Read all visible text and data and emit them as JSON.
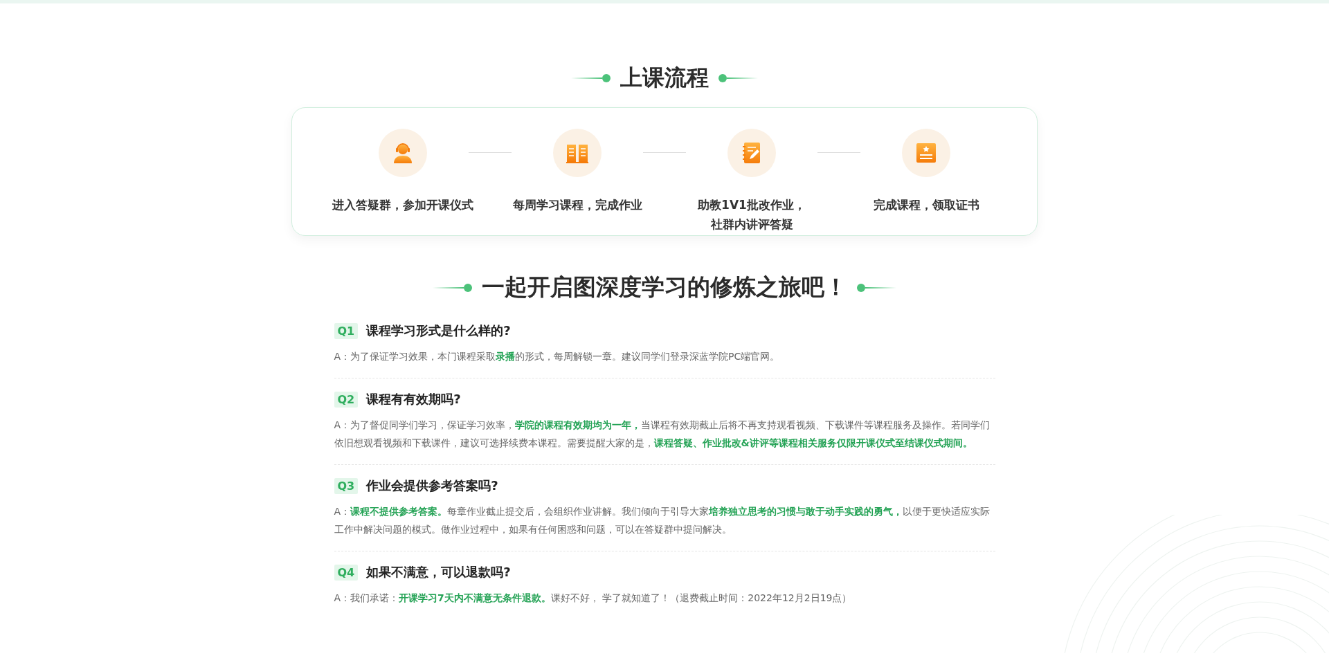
{
  "process": {
    "title": "上课流程",
    "steps": [
      {
        "kind": "headset",
        "lines": [
          "进入答疑群，参加开课仪式"
        ]
      },
      {
        "kind": "book",
        "lines": [
          "每周学习课程，完成作业"
        ]
      },
      {
        "kind": "notebook",
        "lines": [
          "助教1V1批改作业，",
          "社群内讲评答疑"
        ]
      },
      {
        "kind": "certificate",
        "lines": [
          "完成课程，领取证书"
        ]
      }
    ]
  },
  "faq": {
    "title": "一起开启图深度学习的修炼之旅吧！",
    "items": [
      {
        "tag": "Q1",
        "question": "课程学习形式是什么样的?",
        "answer": "A：为了保证学习效果，本门课程采取**录播**的形式，每周解锁一章。建议同学们登录深蓝学院PC端官网。"
      },
      {
        "tag": "Q2",
        "question": "课程有有效期吗?",
        "answer": "A：为了督促同学们学习，保证学习效率，**学院的课程有效期均为一年，**当课程有效期截止后将不再支持观看视频、下载课件等课程服务及操作。若同学们依旧想观看视频和下载课件，建议可选择续费本课程。需要提醒大家的是，**课程答疑、作业批改&讲评等课程相关服务仅限开课仪式至结课仪式期间。**"
      },
      {
        "tag": "Q3",
        "question": "作业会提供参考答案吗?",
        "answer": "A：**课程不提供参考答案。**每章作业截止提交后，会组织作业讲解。我们倾向于引导大家**培养独立思考的习惯与敢于动手实践的勇气，**以便于更快适应实际工作中解决问题的模式。做作业过程中，如果有任何困惑和问题，可以在答疑群中提问解决。"
      },
      {
        "tag": "Q4",
        "question": "如果不满意，可以退款吗?",
        "answer": "A：我们承诺：**开课学习7天内不满意无条件退款。**课好不好， 学了就知道了！（退费截止时间：2022年12月2日19点）"
      }
    ]
  }
}
